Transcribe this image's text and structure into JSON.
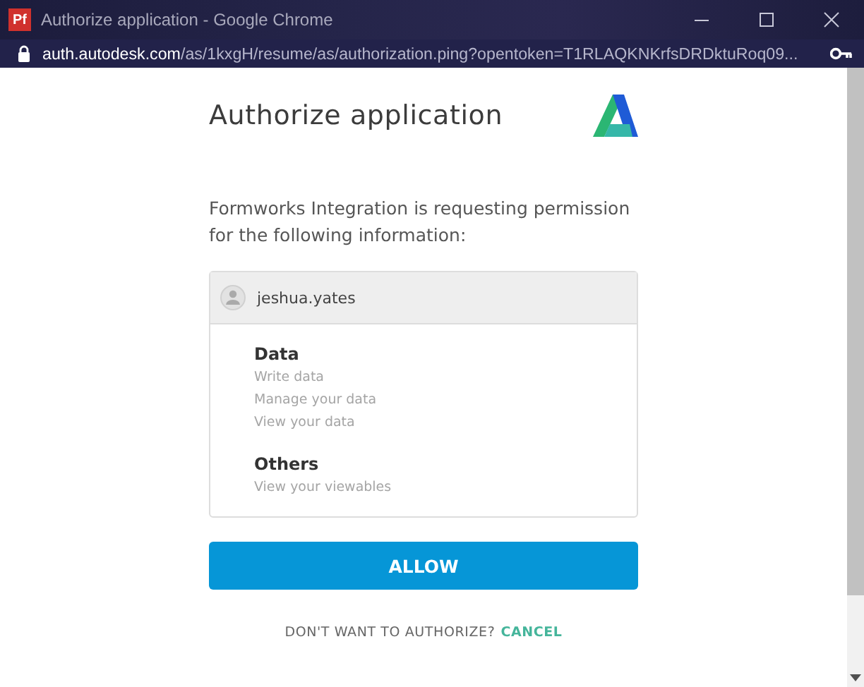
{
  "window": {
    "title": "Authorize application - Google Chrome",
    "app_badge": "Pf"
  },
  "address_bar": {
    "host": "auth.autodesk.com",
    "path": "/as/1kxgH/resume/as/authorization.ping?opentoken=T1RLAQKNKrfsDRDktuRoq09..."
  },
  "heading": "Authorize application",
  "description": "Formworks Integration is requesting permission for the following information:",
  "account": {
    "username": "jeshua.yates"
  },
  "permission_groups": [
    {
      "title": "Data",
      "items": [
        "Write data",
        "Manage your data",
        "View your data"
      ]
    },
    {
      "title": "Others",
      "items": [
        "View your viewables"
      ]
    }
  ],
  "allow_button": "ALLOW",
  "cancel_prompt": {
    "question": "DON'T WANT TO AUTHORIZE?",
    "link": "CANCEL"
  }
}
